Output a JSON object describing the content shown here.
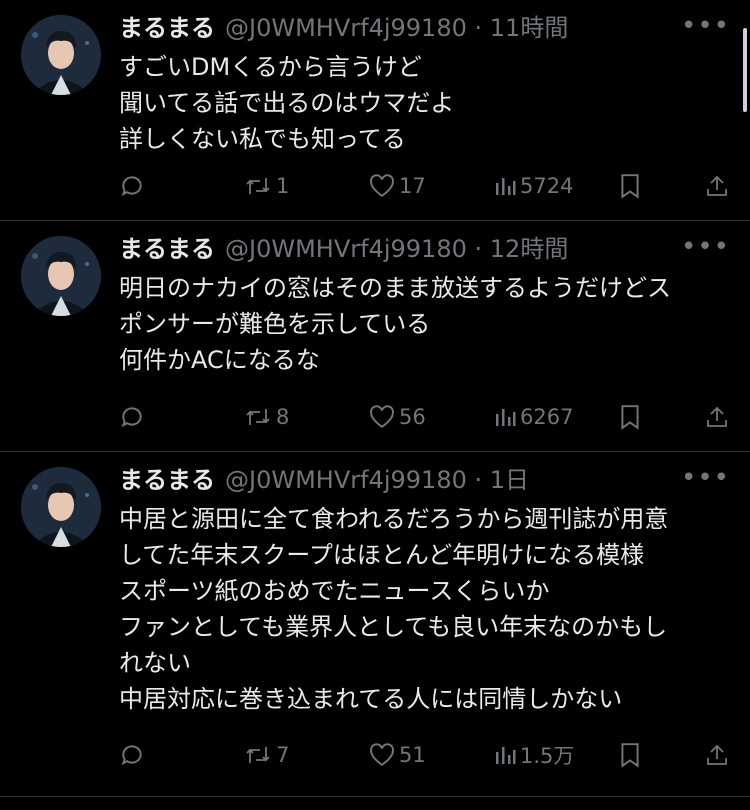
{
  "tweets": [
    {
      "name": "まるまる",
      "handle": "@J0WMHVrf4j99180",
      "time": "11時間",
      "lines": [
        "すごいDMくるから言うけど",
        "聞いてる話で出るのはウマだよ",
        "詳しくない私でも知ってる"
      ],
      "retweets": "1",
      "likes": "17",
      "views": "5724"
    },
    {
      "name": "まるまる",
      "handle": "@J0WMHVrf4j99180",
      "time": "12時間",
      "lines": [
        "明日のナカイの窓はそのまま放送するようだけどス",
        "ポンサーが難色を示している",
        "何件かACになるな"
      ],
      "retweets": "8",
      "likes": "56",
      "views": "6267"
    },
    {
      "name": "まるまる",
      "handle": "@J0WMHVrf4j99180",
      "time": "1日",
      "lines": [
        "中居と源田に全て食われるだろうから週刊誌が用意",
        "してた年末スクープはほとんど年明けになる模様",
        "スポーツ紙のおめでたニュースくらいか",
        "ファンとしても業界人としても良い年末なのかもし",
        "れない",
        "中居対応に巻き込まれてる人には同情しかない"
      ],
      "retweets": "7",
      "likes": "51",
      "views": "1.5万"
    }
  ],
  "separator": "·",
  "more_icon": "more-horizontal-icon",
  "colors": {
    "background": "#000000",
    "text": "#e7e9ea",
    "secondary": "#71767b",
    "divider": "#2f3336"
  }
}
